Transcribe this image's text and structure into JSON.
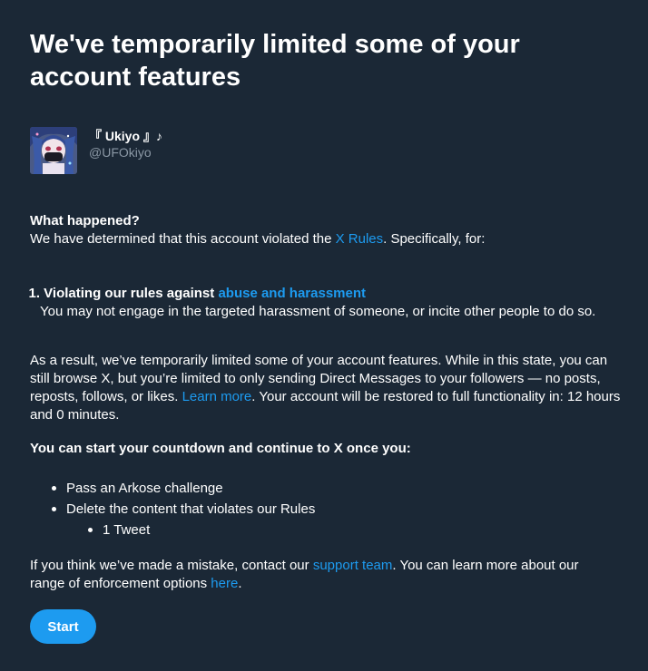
{
  "title": "We've temporarily limited some of your account features",
  "profile": {
    "display_name": "『 Ukiyo 』♪",
    "handle": "@UFOkiyo"
  },
  "what_happened": {
    "heading": "What happened?",
    "text_before": "We have determined that this account violated the ",
    "rules_link": "X Rules",
    "text_after": ". Specifically, for:"
  },
  "violation": {
    "number": "1.",
    "title_prefix": "Violating our rules against ",
    "title_link": "abuse and harassment",
    "description": "You may not engage in the targeted harassment of someone, or incite other people to do so."
  },
  "result": {
    "text_1": "As a result, we’ve temporarily limited some of your account features. While in this state, you can still browse X, but you’re limited to only sending Direct Messages to your followers — no posts, reposts, follows, or likes. ",
    "learn_more_link": "Learn more",
    "text_2": ". Your account will be restored to full functionality in: 12 hours and 0 minutes."
  },
  "countdown_heading": "You can start your countdown and continue to X once you:",
  "requirements": {
    "item_1": "Pass an Arkose challenge",
    "item_2": "Delete the content that violates our Rules",
    "sub_item_1": "1 Tweet"
  },
  "mistake": {
    "text_1": "If you think we’ve made a mistake, contact our ",
    "support_link": "support team",
    "text_2": ". You can learn more about our range of enforcement options ",
    "here_link": "here",
    "text_3": "."
  },
  "start_button": "Start",
  "colors": {
    "background": "#1b2836",
    "link": "#1d9bf0",
    "secondary_text": "#8b98a5",
    "button": "#1d9bf0"
  }
}
